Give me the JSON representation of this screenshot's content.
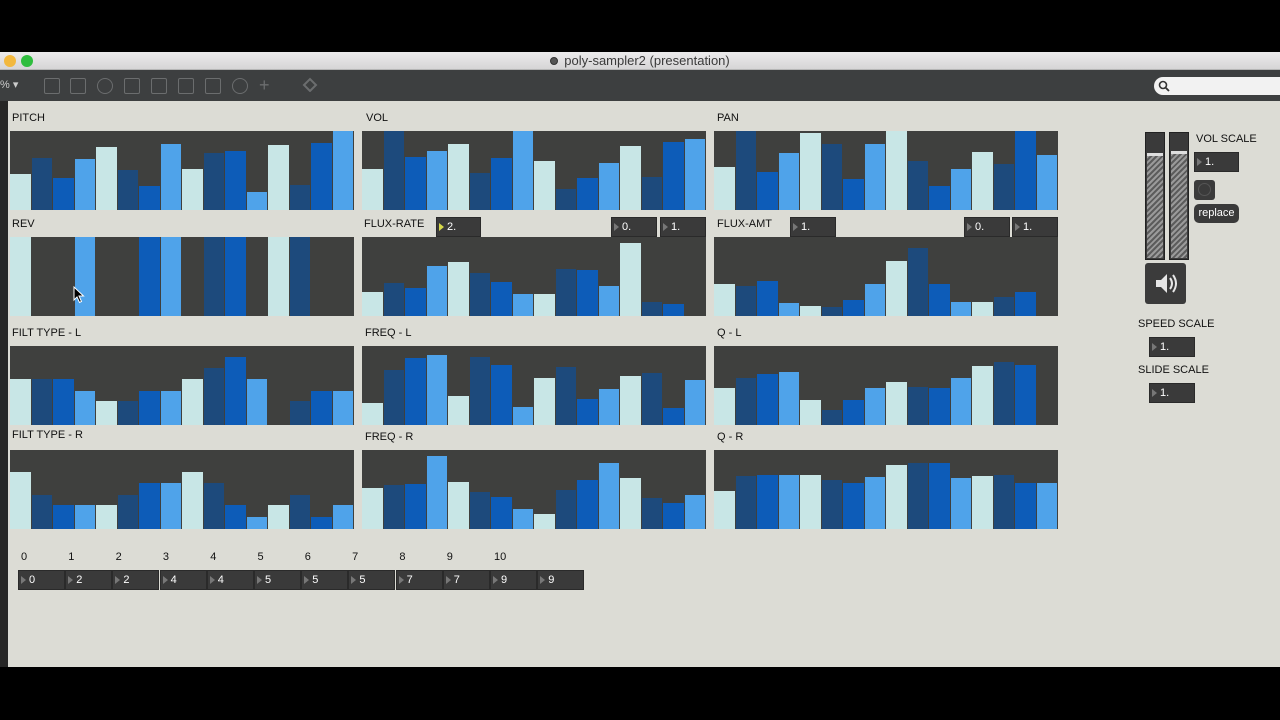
{
  "window": {
    "title": "poly-sampler2 (presentation)",
    "zoom": "% ▾"
  },
  "colors": {
    "light": "#c8e6e6",
    "dark": "#1d4a7c",
    "mid": "#0d5cb8",
    "bright": "#4fa3ea",
    "panel": "#3f403e"
  },
  "panels": {
    "pitch": {
      "label": "PITCH",
      "bars": [
        [
          0.45,
          "light"
        ],
        [
          0.66,
          "dark"
        ],
        [
          0.4,
          "mid"
        ],
        [
          0.65,
          "bright"
        ],
        [
          0.8,
          "light"
        ],
        [
          0.5,
          "dark"
        ],
        [
          0.3,
          "mid"
        ],
        [
          0.84,
          "bright"
        ],
        [
          0.52,
          "light"
        ],
        [
          0.72,
          "dark"
        ],
        [
          0.75,
          "mid"
        ],
        [
          0.23,
          "bright"
        ],
        [
          0.82,
          "light"
        ],
        [
          0.32,
          "dark"
        ],
        [
          0.85,
          "mid"
        ],
        [
          1,
          "bright"
        ]
      ]
    },
    "vol": {
      "label": "VOL",
      "bars": [
        [
          0.52,
          "light"
        ],
        [
          1,
          "dark"
        ],
        [
          0.67,
          "mid"
        ],
        [
          0.75,
          "bright"
        ],
        [
          0.84,
          "light"
        ],
        [
          0.47,
          "dark"
        ],
        [
          0.66,
          "mid"
        ],
        [
          1,
          "bright"
        ],
        [
          0.62,
          "light"
        ],
        [
          0.26,
          "dark"
        ],
        [
          0.41,
          "mid"
        ],
        [
          0.6,
          "bright"
        ],
        [
          0.81,
          "light"
        ],
        [
          0.42,
          "dark"
        ],
        [
          0.86,
          "mid"
        ],
        [
          0.9,
          "bright"
        ]
      ]
    },
    "pan": {
      "label": "PAN",
      "bars": [
        [
          0.55,
          "light"
        ],
        [
          1,
          "dark"
        ],
        [
          0.48,
          "mid"
        ],
        [
          0.72,
          "bright"
        ],
        [
          0.97,
          "light"
        ],
        [
          0.84,
          "dark"
        ],
        [
          0.39,
          "mid"
        ],
        [
          0.84,
          "bright"
        ],
        [
          1,
          "light"
        ],
        [
          0.62,
          "dark"
        ],
        [
          0.3,
          "mid"
        ],
        [
          0.52,
          "bright"
        ],
        [
          0.73,
          "light"
        ],
        [
          0.58,
          "dark"
        ],
        [
          1,
          "mid"
        ],
        [
          0.7,
          "bright"
        ]
      ]
    },
    "rev": {
      "label": "REV",
      "bars": [
        [
          1,
          "light"
        ],
        [
          0,
          "dark"
        ],
        [
          0,
          "mid"
        ],
        [
          1,
          "bright"
        ],
        [
          0,
          "light"
        ],
        [
          0,
          "dark"
        ],
        [
          1,
          "mid"
        ],
        [
          1,
          "bright"
        ],
        [
          0,
          "light"
        ],
        [
          1,
          "dark"
        ],
        [
          1,
          "mid"
        ],
        [
          0,
          "bright"
        ],
        [
          1,
          "light"
        ],
        [
          1,
          "dark"
        ],
        [
          0,
          "mid"
        ],
        [
          0,
          "bright"
        ]
      ]
    },
    "flux_rate": {
      "label": "FLUX-RATE",
      "bars": [
        [
          0.3,
          "light"
        ],
        [
          0.42,
          "dark"
        ],
        [
          0.36,
          "mid"
        ],
        [
          0.63,
          "bright"
        ],
        [
          0.68,
          "light"
        ],
        [
          0.55,
          "dark"
        ],
        [
          0.43,
          "mid"
        ],
        [
          0.28,
          "bright"
        ],
        [
          0.28,
          "light"
        ],
        [
          0.6,
          "dark"
        ],
        [
          0.58,
          "mid"
        ],
        [
          0.38,
          "bright"
        ],
        [
          0.93,
          "light"
        ],
        [
          0.18,
          "dark"
        ],
        [
          0.15,
          "mid"
        ],
        [
          0,
          "bright"
        ]
      ]
    },
    "flux_amt": {
      "label": "FLUX-AMT",
      "bars": [
        [
          0.4,
          "light"
        ],
        [
          0.38,
          "dark"
        ],
        [
          0.44,
          "mid"
        ],
        [
          0.17,
          "bright"
        ],
        [
          0.13,
          "light"
        ],
        [
          0.11,
          "dark"
        ],
        [
          0.2,
          "mid"
        ],
        [
          0.4,
          "bright"
        ],
        [
          0.7,
          "light"
        ],
        [
          0.86,
          "dark"
        ],
        [
          0.41,
          "mid"
        ],
        [
          0.18,
          "bright"
        ],
        [
          0.18,
          "light"
        ],
        [
          0.24,
          "dark"
        ],
        [
          0.3,
          "mid"
        ],
        [
          0,
          "bright"
        ]
      ]
    },
    "filt_type_l": {
      "label": "FILT TYPE - L",
      "bars": [
        [
          0.58,
          "light"
        ],
        [
          0.58,
          "dark"
        ],
        [
          0.58,
          "mid"
        ],
        [
          0.43,
          "bright"
        ],
        [
          0.3,
          "light"
        ],
        [
          0.3,
          "dark"
        ],
        [
          0.43,
          "mid"
        ],
        [
          0.43,
          "bright"
        ],
        [
          0.58,
          "light"
        ],
        [
          0.72,
          "dark"
        ],
        [
          0.86,
          "mid"
        ],
        [
          0.58,
          "bright"
        ],
        [
          0,
          "light"
        ],
        [
          0.3,
          "dark"
        ],
        [
          0.43,
          "mid"
        ],
        [
          0.43,
          "bright"
        ]
      ]
    },
    "freq_l": {
      "label": "FREQ - L",
      "bars": [
        [
          0.28,
          "light"
        ],
        [
          0.7,
          "dark"
        ],
        [
          0.85,
          "mid"
        ],
        [
          0.88,
          "bright"
        ],
        [
          0.37,
          "light"
        ],
        [
          0.86,
          "dark"
        ],
        [
          0.76,
          "mid"
        ],
        [
          0.23,
          "bright"
        ],
        [
          0.6,
          "light"
        ],
        [
          0.73,
          "dark"
        ],
        [
          0.33,
          "mid"
        ],
        [
          0.46,
          "bright"
        ],
        [
          0.62,
          "light"
        ],
        [
          0.66,
          "dark"
        ],
        [
          0.21,
          "mid"
        ],
        [
          0.57,
          "bright"
        ]
      ]
    },
    "q_l": {
      "label": "Q - L",
      "bars": [
        [
          0.47,
          "light"
        ],
        [
          0.6,
          "dark"
        ],
        [
          0.65,
          "mid"
        ],
        [
          0.67,
          "bright"
        ],
        [
          0.32,
          "light"
        ],
        [
          0.19,
          "dark"
        ],
        [
          0.32,
          "mid"
        ],
        [
          0.47,
          "bright"
        ],
        [
          0.55,
          "light"
        ],
        [
          0.48,
          "dark"
        ],
        [
          0.47,
          "mid"
        ],
        [
          0.6,
          "bright"
        ],
        [
          0.75,
          "light"
        ],
        [
          0.8,
          "dark"
        ],
        [
          0.76,
          "mid"
        ],
        [
          0
        ]
      ]
    },
    "filt_type_r": {
      "label": "FILT TYPE - R",
      "bars": [
        [
          0.72,
          "light"
        ],
        [
          0.43,
          "dark"
        ],
        [
          0.3,
          "mid"
        ],
        [
          0.3,
          "bright"
        ],
        [
          0.3,
          "light"
        ],
        [
          0.43,
          "dark"
        ],
        [
          0.58,
          "mid"
        ],
        [
          0.58,
          "bright"
        ],
        [
          0.72,
          "light"
        ],
        [
          0.58,
          "dark"
        ],
        [
          0.3,
          "mid"
        ],
        [
          0.15,
          "bright"
        ],
        [
          0.3,
          "light"
        ],
        [
          0.43,
          "dark"
        ],
        [
          0.15,
          "mid"
        ],
        [
          0.3,
          "bright"
        ]
      ]
    },
    "freq_r": {
      "label": "FREQ - R",
      "bars": [
        [
          0.52,
          "light"
        ],
        [
          0.56,
          "dark"
        ],
        [
          0.57,
          "mid"
        ],
        [
          0.93,
          "bright"
        ],
        [
          0.6,
          "light"
        ],
        [
          0.47,
          "dark"
        ],
        [
          0.4,
          "mid"
        ],
        [
          0.25,
          "bright"
        ],
        [
          0.19,
          "light"
        ],
        [
          0.49,
          "dark"
        ],
        [
          0.62,
          "mid"
        ],
        [
          0.84,
          "bright"
        ],
        [
          0.65,
          "light"
        ],
        [
          0.39,
          "dark"
        ],
        [
          0.33,
          "mid"
        ],
        [
          0.43,
          "bright"
        ]
      ]
    },
    "q_r": {
      "label": "Q - R",
      "bars": [
        [
          0.48,
          "light"
        ],
        [
          0.67,
          "dark"
        ],
        [
          0.68,
          "mid"
        ],
        [
          0.68,
          "bright"
        ],
        [
          0.68,
          "light"
        ],
        [
          0.62,
          "dark"
        ],
        [
          0.58,
          "mid"
        ],
        [
          0.66,
          "bright"
        ],
        [
          0.81,
          "light"
        ],
        [
          0.84,
          "dark"
        ],
        [
          0.83,
          "mid"
        ],
        [
          0.64,
          "bright"
        ],
        [
          0.67,
          "light"
        ],
        [
          0.68,
          "dark"
        ],
        [
          0.58,
          "mid"
        ],
        [
          0.58,
          "bright"
        ]
      ]
    }
  },
  "flux_rate_boxes": [
    "2.",
    "0.",
    "1."
  ],
  "flux_amt_boxes": [
    "1.",
    "0.",
    "1."
  ],
  "right": {
    "vol_scale_label": "VOL SCALE",
    "vol_scale_value": "1.",
    "speed_scale_label": "SPEED SCALE",
    "speed_scale_value": "1.",
    "slide_scale_label": "SLIDE SCALE",
    "slide_scale_value": "1.",
    "replace_label": "replace",
    "meter_levels": [
      0.82,
      0.84
    ]
  },
  "step_labels": [
    "0",
    "1",
    "2",
    "3",
    "4",
    "5",
    "6",
    "7",
    "8",
    "9",
    "10"
  ],
  "step_values": [
    "0",
    "2",
    "2",
    "4",
    "4",
    "5",
    "5",
    "5",
    "7",
    "7",
    "9",
    "9"
  ]
}
